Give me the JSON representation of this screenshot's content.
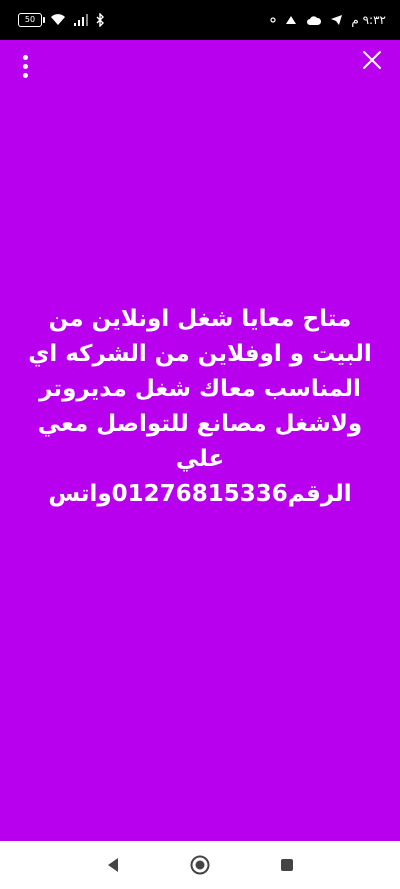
{
  "status_bar": {
    "time": "٩:٣٢ م",
    "battery_level": "50",
    "icons": [
      "wifi-icon",
      "signal-icon",
      "bluetooth-icon",
      "telegram-icon",
      "cloud-icon",
      "gesture-icon",
      "dot-icon"
    ]
  },
  "story": {
    "background_color": "#b800ee",
    "caption_lines": [
      "متاح معايا شغل اونلاين من",
      "البيت و اوفلاين من الشركه اي",
      "المناسب معاك شغل مديروتر",
      "ولاشغل مصانع للتواصل معي",
      "علي",
      "الرقم01276815336واتس"
    ]
  },
  "nav_bar": {
    "buttons": [
      "back-icon",
      "home-icon",
      "recents-icon"
    ]
  }
}
